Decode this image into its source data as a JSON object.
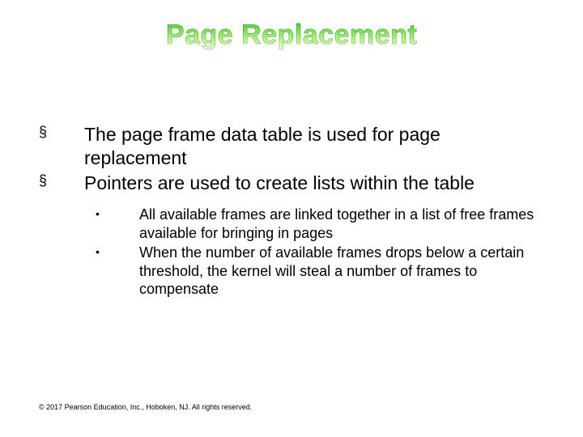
{
  "title": "Page Replacement",
  "bullets": [
    {
      "marker": "§",
      "text": "The page frame data table is used for page replacement"
    },
    {
      "marker": "§",
      "text": "Pointers are used to create lists within the table"
    }
  ],
  "subbullets": [
    {
      "marker": "•",
      "text": "All available frames are linked together in a list of free frames available for bringing in pages"
    },
    {
      "marker": "•",
      "text": "When the number of available frames drops below a certain threshold, the kernel will steal a number of frames to compensate"
    }
  ],
  "footer": "© 2017 Pearson Education, Inc., Hoboken, NJ. All rights reserved."
}
